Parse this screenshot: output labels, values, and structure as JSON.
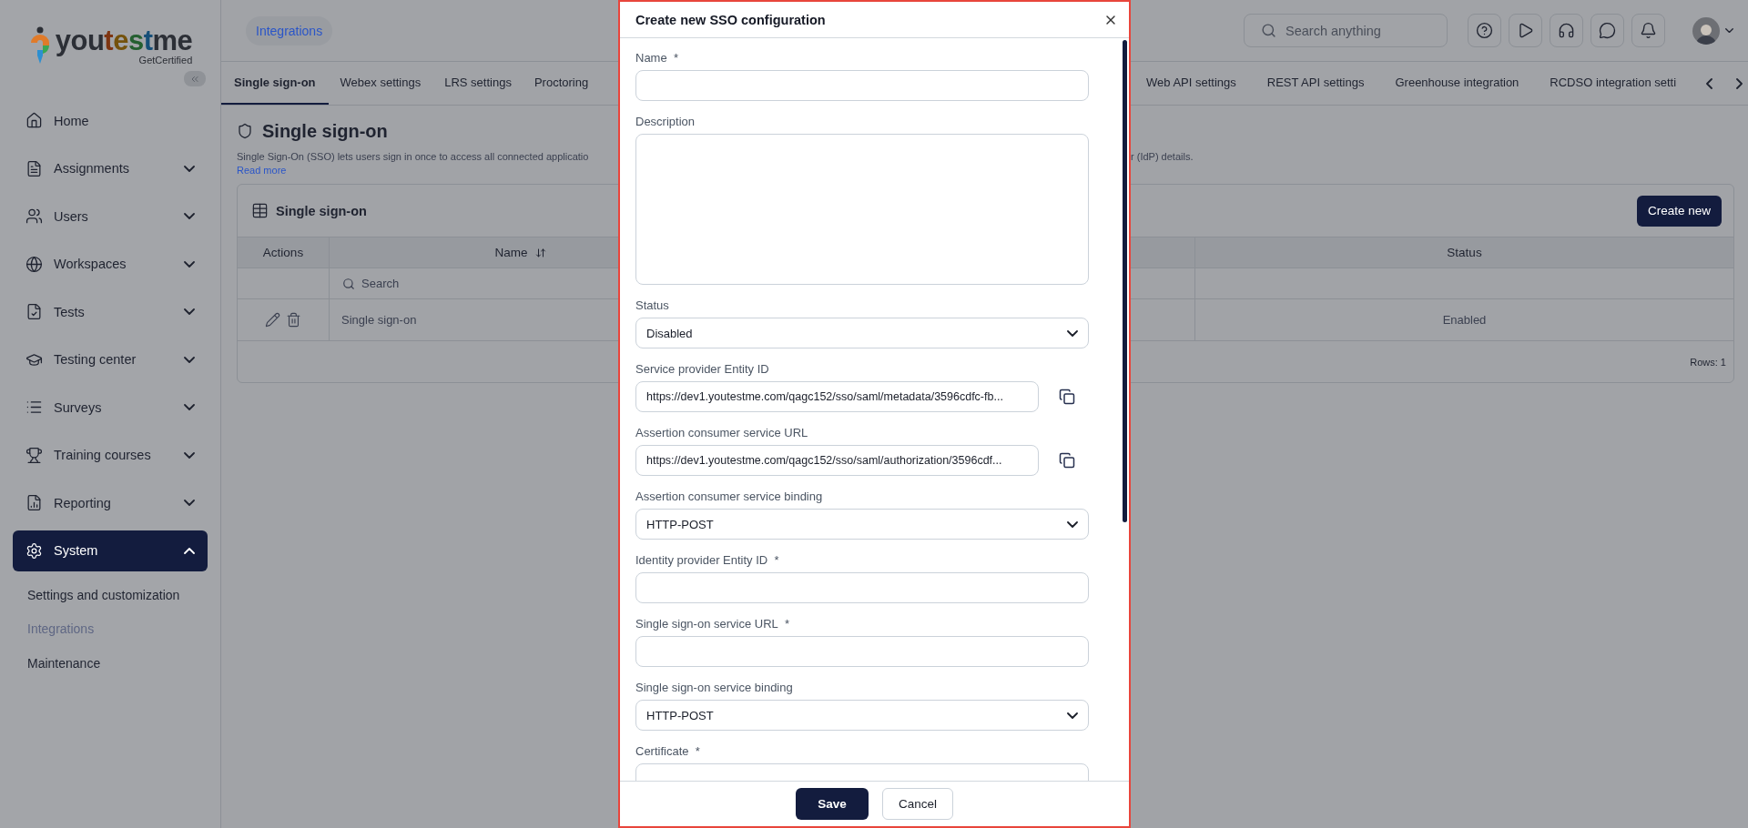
{
  "sidebar": {
    "logo": {
      "wordmark": "youtestme",
      "tagline": "GetCertified"
    },
    "items": [
      {
        "label": "Home",
        "expandable": false,
        "selected": false
      },
      {
        "label": "Assignments",
        "expandable": true,
        "expanded": false,
        "selected": false
      },
      {
        "label": "Users",
        "expandable": true,
        "expanded": false,
        "selected": false
      },
      {
        "label": "Workspaces",
        "expandable": true,
        "expanded": false,
        "selected": false
      },
      {
        "label": "Tests",
        "expandable": true,
        "expanded": false,
        "selected": false
      },
      {
        "label": "Testing center",
        "expandable": true,
        "expanded": false,
        "selected": false
      },
      {
        "label": "Surveys",
        "expandable": true,
        "expanded": false,
        "selected": false
      },
      {
        "label": "Training courses",
        "expandable": true,
        "expanded": false,
        "selected": false
      },
      {
        "label": "Reporting",
        "expandable": true,
        "expanded": false,
        "selected": false
      },
      {
        "label": "System",
        "expandable": true,
        "expanded": true,
        "selected": true,
        "children": [
          {
            "label": "Settings and customization",
            "selected": false
          },
          {
            "label": "Integrations",
            "selected": true
          },
          {
            "label": "Maintenance",
            "selected": false
          }
        ]
      }
    ]
  },
  "header": {
    "breadcrumb": "Integrations",
    "search": {
      "placeholder": "Search anything"
    }
  },
  "tabs": [
    {
      "label": "Single sign-on",
      "selected": true
    },
    {
      "label": "Webex settings",
      "selected": false
    },
    {
      "label": "LRS settings",
      "selected": false
    },
    {
      "label": "Proctoring",
      "selected": false
    },
    {
      "label": "Web API settings",
      "selected": false
    },
    {
      "label": "REST API settings",
      "selected": false
    },
    {
      "label": "Greenhouse integration",
      "selected": false
    },
    {
      "label": "RCDSO integration setti",
      "selected": false
    }
  ],
  "page": {
    "title": "Single sign-on",
    "description_fragments": [
      "Single Sign-On (SSO) lets users sign in once to access all connected applicatio",
      "r (IdP) details."
    ],
    "read_more": "Read more"
  },
  "card": {
    "title": "Single sign-on",
    "create_button": "Create new",
    "table": {
      "columns": [
        {
          "label": "Actions",
          "sortable": false
        },
        {
          "label": "Name",
          "sortable": true
        },
        {
          "label": "Status",
          "sortable": false
        }
      ],
      "filter": {
        "placeholder": "Search"
      },
      "rows": [
        {
          "name": "Single sign-on",
          "status": "Enabled"
        }
      ],
      "footer": "Rows: 1"
    }
  },
  "dialog": {
    "title": "Create new SSO configuration",
    "fields": [
      {
        "kind": "text",
        "label": "Name",
        "required_mark": "*"
      },
      {
        "kind": "textarea",
        "label": "Description"
      },
      {
        "kind": "select",
        "label": "Status",
        "value": "Disabled"
      },
      {
        "kind": "copy",
        "label": "Service provider Entity ID",
        "value": "https://dev1.youtestme.com/qagc152/sso/saml/metadata/3596cdfc-fb..."
      },
      {
        "kind": "copy",
        "label": "Assertion consumer service URL",
        "value": "https://dev1.youtestme.com/qagc152/sso/saml/authorization/3596cdf..."
      },
      {
        "kind": "select",
        "label": "Assertion consumer service binding",
        "value": "HTTP-POST"
      },
      {
        "kind": "text",
        "label": "Identity provider Entity ID",
        "required_mark": "*"
      },
      {
        "kind": "text",
        "label": "Single sign-on service URL",
        "required_mark": "*"
      },
      {
        "kind": "select",
        "label": "Single sign-on service binding",
        "value": "HTTP-POST"
      },
      {
        "kind": "text",
        "label": "Certificate",
        "required_mark": "*"
      }
    ],
    "buttons": {
      "save": "Save",
      "cancel": "Cancel"
    }
  }
}
